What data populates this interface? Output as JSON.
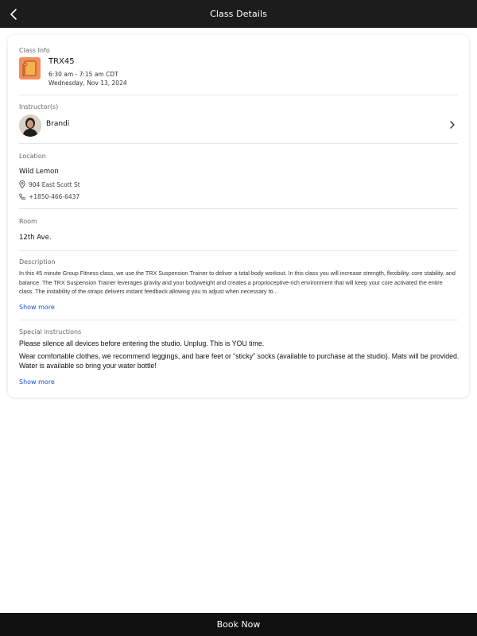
{
  "header": {
    "title": "Class Details"
  },
  "class_info": {
    "label": "Class Info",
    "name": "TRX45",
    "time": "6:30 am - 7:15 am CDT",
    "date": "Wednesday, Nov 13, 2024"
  },
  "instructors": {
    "label": "Instructor(s)",
    "name": "Brandi"
  },
  "location": {
    "label": "Location",
    "name": "Wild Lemon",
    "address": "904 East Scott St",
    "phone": "+1850-466-6437"
  },
  "room": {
    "label": "Room",
    "name": "12th Ave."
  },
  "description": {
    "label": "Description",
    "text": "In this 45 minute Group Fitness class, we use the TRX Suspension Trainer to deliver a total body workout. In this class you will increase strength, flexibility, core stability, and balance. The TRX Suspension Trainer leverages gravity and your bodyweight and creates a proprioceptive-rich environment that will keep your core activated the entire class. The instability of the straps delivers instant feedback allowing you to adjust when necessary to...",
    "show_more": "Show more"
  },
  "special_instructions": {
    "label": "Special instructions",
    "line1": "Please silence all devices before entering the studio. Unplug. This is YOU time.",
    "line2": "Wear comfortable clothes, we recommend leggings, and bare feet or “sticky” socks (available to purchase at the studio). Mats will be provided. Water is available so bring your water bottle!",
    "show_more": "Show more"
  },
  "footer": {
    "book_label": "Book Now"
  },
  "colors": {
    "topbar": "#1c1c1c",
    "class_thumb": "#f28d5c",
    "link": "#1a4fd8",
    "bottombar": "#111111"
  },
  "icons": {
    "back": "chevron-left-icon",
    "class": "yoga-mat-icon",
    "instructor_nav": "chevron-right-icon",
    "address": "map-pin-icon",
    "phone": "phone-icon"
  }
}
